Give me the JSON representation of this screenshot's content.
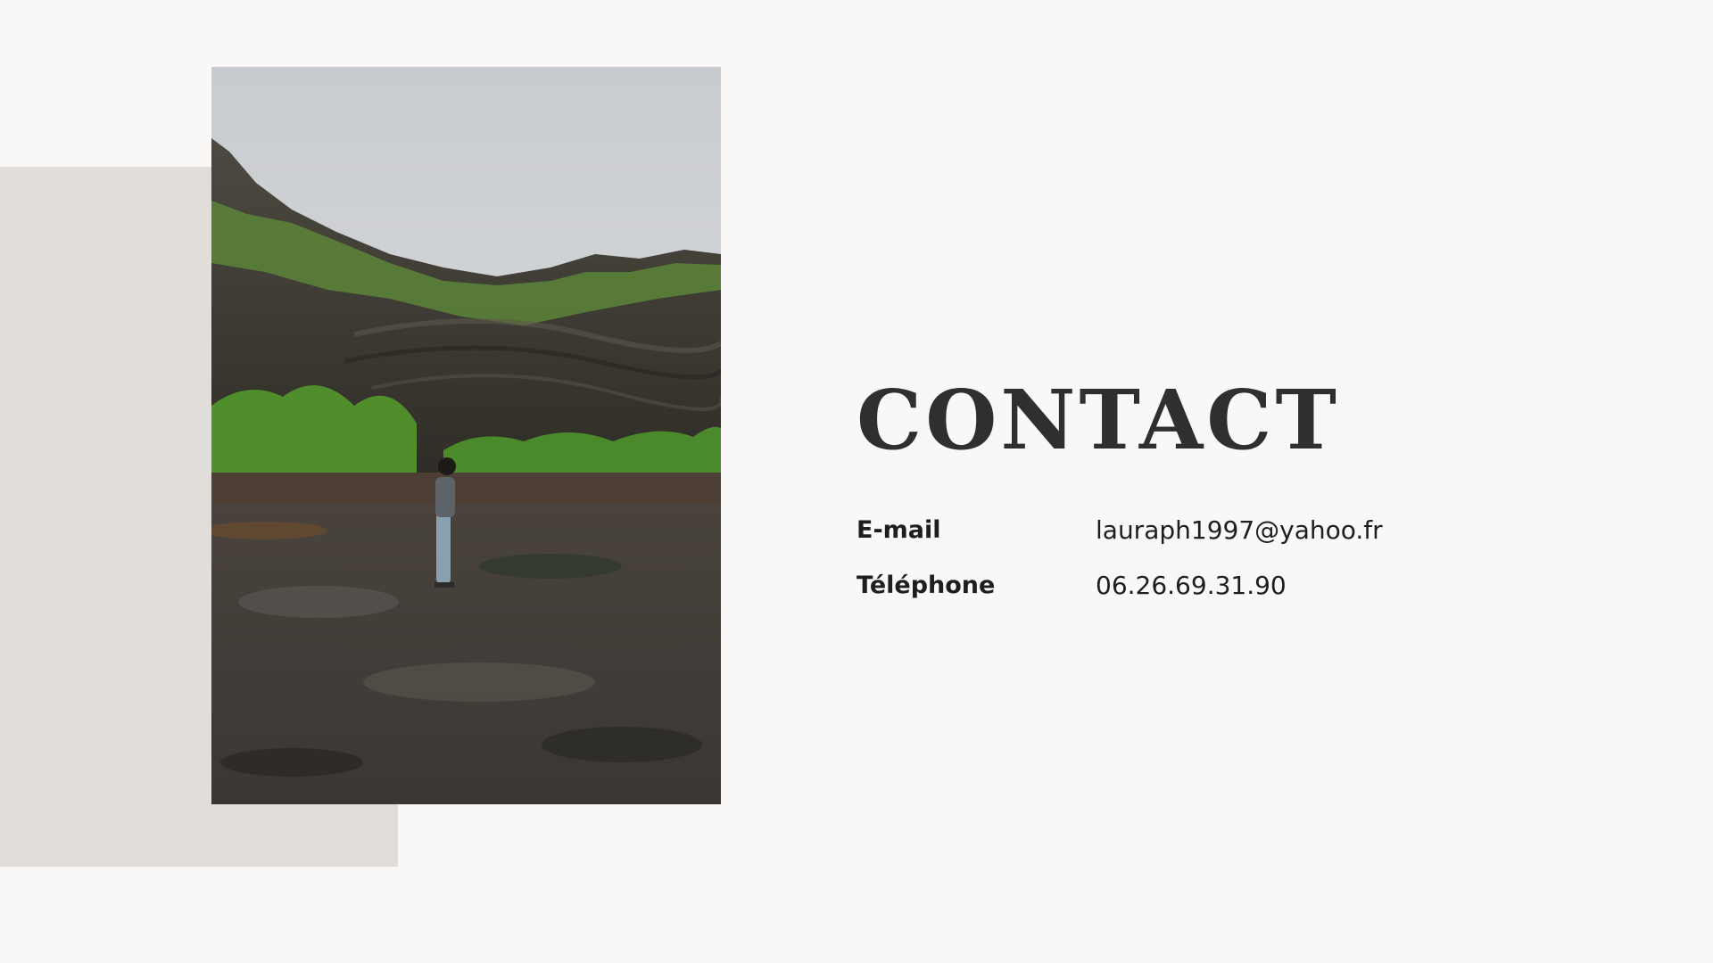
{
  "title": "CONTACT",
  "contacts": [
    {
      "label": "E-mail",
      "value": "lauraph1997@yahoo.fr"
    },
    {
      "label": "Téléphone",
      "value": "06.26.69.31.90"
    }
  ],
  "colors": {
    "background": "#f9f8f6",
    "accent_block": "#e1ddd9",
    "text": "#1e1e1e",
    "title": "#2f2f2f"
  }
}
